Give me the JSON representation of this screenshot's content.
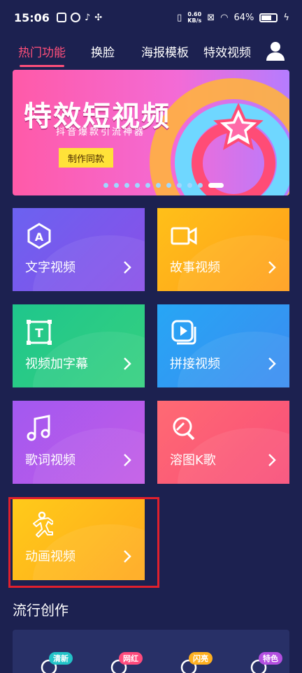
{
  "status": {
    "time": "15:06",
    "speed_top": "0.60",
    "speed_unit": "KB/s",
    "battery": "64%"
  },
  "nav": {
    "tabs": [
      {
        "label": "热门功能"
      },
      {
        "label": "换脸"
      },
      {
        "label": "海报模板"
      },
      {
        "label": "特效视频"
      }
    ],
    "active_index": 0
  },
  "banner": {
    "title": "特效短视频",
    "subtitle": "抖音爆款引流神器",
    "button": "制作同款",
    "page_count": 11,
    "active_page": 11
  },
  "features": [
    {
      "label": "文字视频",
      "icon": "text-a-icon",
      "gradient": [
        "#6b62f0",
        "#8a4fe8"
      ]
    },
    {
      "label": "故事视频",
      "icon": "camera-icon",
      "gradient": [
        "#ffc019",
        "#ff9e1b"
      ]
    },
    {
      "label": "视频加字幕",
      "icon": "subtitle-t-icon",
      "gradient": [
        "#1fc68c",
        "#35d07f"
      ]
    },
    {
      "label": "拼接视频",
      "icon": "play-stack-icon",
      "gradient": [
        "#27a6f5",
        "#3b8cf0"
      ]
    },
    {
      "label": "歌词视频",
      "icon": "music-note-icon",
      "gradient": [
        "#a259f0",
        "#c35ae6"
      ]
    },
    {
      "label": "溶图K歌",
      "icon": "mic-icon",
      "gradient": [
        "#ff6a73",
        "#f84e7a"
      ]
    },
    {
      "label": "动画视频",
      "icon": "running-person-icon",
      "gradient": [
        "#ffcb1a",
        "#ffa81c"
      ]
    }
  ],
  "section": {
    "title": "流行创作"
  },
  "bottom_categories": [
    {
      "badge": "清新",
      "color": "#23c3c8"
    },
    {
      "badge": "网红",
      "color": "#ff4b7d"
    },
    {
      "badge": "闪亮",
      "color": "#ffb020"
    },
    {
      "badge": "特色",
      "color": "#b34fe0"
    }
  ],
  "colors": {
    "background": "#1c2150",
    "accent": "#ff4f7a",
    "highlight": "#e0202d"
  }
}
